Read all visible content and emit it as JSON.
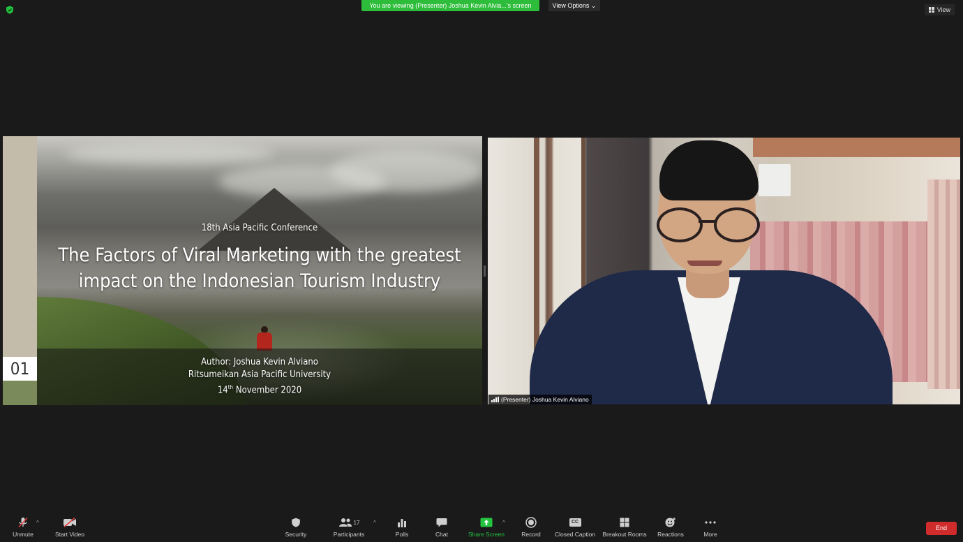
{
  "topbar": {
    "banner_text": "You are viewing (Presenter) Joshua Kevin Alvia...'s screen",
    "view_options_label": "View Options",
    "view_label": "View"
  },
  "slide": {
    "conference": "18th Asia Pacific Conference",
    "title_line1": "The Factors of Viral Marketing with the greatest",
    "title_line2": "impact on the Indonesian Tourism Industry",
    "author": "Author: Joshua Kevin Alviano",
    "university": "Ritsumeikan Asia Pacific University",
    "date_day": "14",
    "date_suffix": "th",
    "date_rest": " November 2020",
    "number": "01"
  },
  "participant": {
    "name_tag": "(Presenter) Joshua Kevin Alviano"
  },
  "toolbar": {
    "unmute": "Unmute",
    "start_video": "Start Video",
    "security": "Security",
    "participants": "Participants",
    "participants_count": "17",
    "polls": "Polls",
    "chat": "Chat",
    "share_screen": "Share Screen",
    "record": "Record",
    "closed_caption": "Closed Caption",
    "closed_caption_icon_text": "CC",
    "breakout_rooms": "Breakout Rooms",
    "reactions": "Reactions",
    "more": "More",
    "end": "End"
  },
  "colors": {
    "background": "#1a1a1a",
    "banner_green": "#2dbd3b",
    "share_green": "#23c440",
    "end_red": "#d12c2c"
  }
}
